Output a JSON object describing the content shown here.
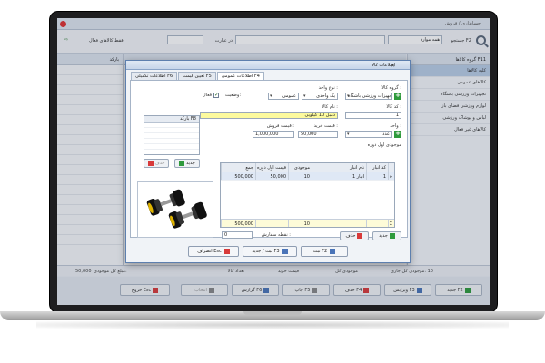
{
  "window": {
    "title": "حسابداری / فروش"
  },
  "toolbar": {
    "search_label": "جستجو F2",
    "search_by_label": "همه موارد",
    "in_label": "در عبارت",
    "only_active_label": "فقط کالاهای فعال",
    "icon_search": "search-icon"
  },
  "left_panel": {
    "header": "بارکد"
  },
  "right_panel": {
    "header": "گروه کالاها F11",
    "items": [
      {
        "label": "کلیه کالاها",
        "selected": true
      },
      {
        "label": "کالاهای عمومی",
        "selected": false
      },
      {
        "label": "تجهیزات ورزشی باشگاه",
        "selected": false
      },
      {
        "label": "لوازم ورزشی فضای باز",
        "selected": false
      },
      {
        "label": "لباس و پوشاک ورزشی",
        "selected": false
      },
      {
        "label": "کالاهای غیر فعال",
        "selected": false
      }
    ]
  },
  "status": {
    "total_label": "موجودی کل جاری:",
    "total_value": "10",
    "count_label": "موجودی کل",
    "buy_label": "قیمت خرید",
    "sale_label": "تعداد کالا",
    "sum_label": "مبلغ کل موجودی:",
    "sum_value": "50,000"
  },
  "bottom_buttons": [
    {
      "label": "جدید F2",
      "icon": "add-icon"
    },
    {
      "label": "ویرایش F3",
      "icon": "edit-icon"
    },
    {
      "label": "حذف F4",
      "icon": "delete-icon"
    },
    {
      "label": "چاپ F5",
      "icon": "print-icon"
    },
    {
      "label": "گزارش F6",
      "icon": "report-icon"
    },
    {
      "label": "انتخاب",
      "icon": "select-icon"
    },
    {
      "label": "خروج Esc",
      "icon": "exit-icon"
    }
  ],
  "dialog": {
    "title": "اطلاعات کالا",
    "tabs": [
      "اطلاعات عمومی F4",
      "تعیین قیمت F5",
      "اطلاعات تکمیلی F6"
    ],
    "group_label": "گروه کالا :",
    "group_value": "تجهیزات ورزشی باشگاه",
    "unit_label": "نوع واحد :",
    "unit_value": "یک واحدی",
    "unit_type_value": "عمومی",
    "status_label": "وضعیت:",
    "active_label": "فعال",
    "code_label": "کد کالا :",
    "code_value": "1",
    "name_label": "نام کالا :",
    "name_value": "دمبل 10 کیلویی",
    "unit2_label": "واحد :",
    "unit2_value": "عدد",
    "buy_price_label": "قیمت خرید :",
    "buy_price_value": "50,000",
    "sale_price_label": "قیمت فروش :",
    "sale_price_value": "1,000,000",
    "opening_stock_label": "موجودی اول دوره",
    "barcode_header": "بارکد F8",
    "barcode_new": "جدید",
    "barcode_delete": "حذف",
    "price_table": {
      "columns": [
        "کد انبار",
        "نام انبار",
        "موجودی",
        "قیمت اول دوره",
        "جمع"
      ],
      "rows": [
        {
          "code": "1",
          "name": "انبار 1",
          "qty": "10",
          "price": "50,000",
          "total": "500,000"
        }
      ],
      "footer_qty": "10",
      "footer_total": "500,000"
    },
    "order_point_label": "نقطه سفارش :",
    "order_point_value": "0",
    "pt_new": "جدید",
    "pt_delete": "حذف",
    "actions": {
      "save": "ثبت F2",
      "save_new": "ثبت / جدید F3",
      "cancel": "انصراف Esc"
    }
  }
}
